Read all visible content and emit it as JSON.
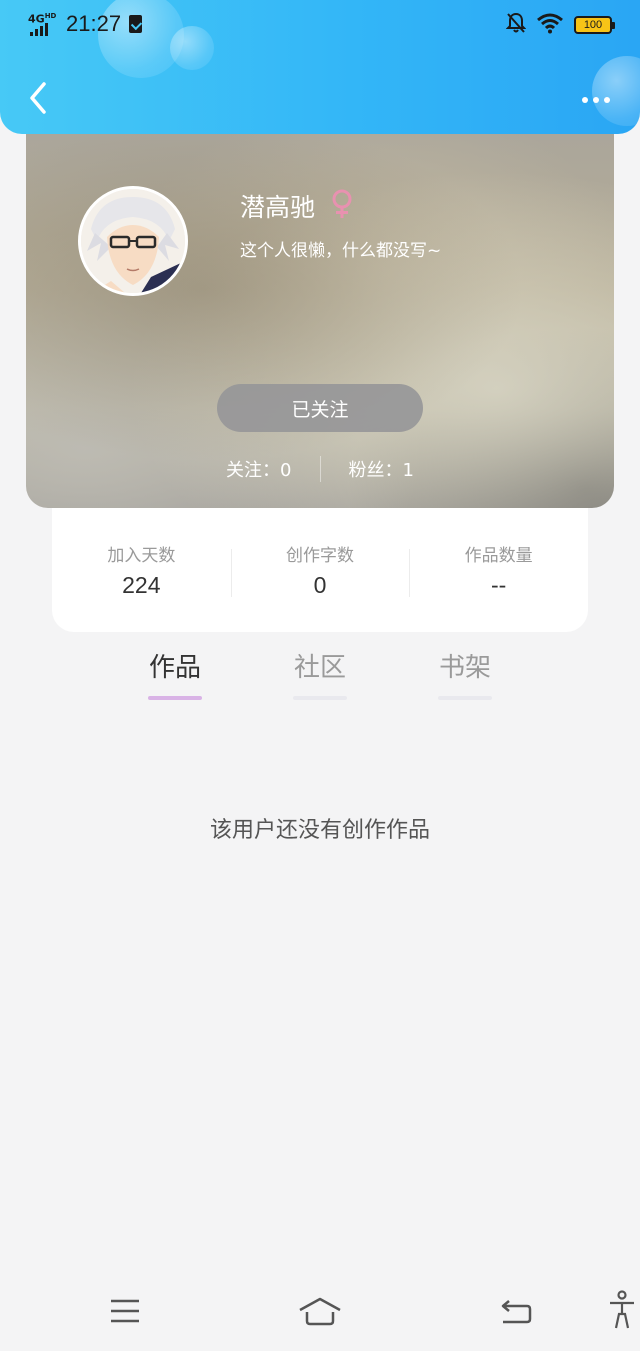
{
  "status_bar": {
    "network": "4G",
    "network_sup": "HD",
    "time": "21:27",
    "battery": "100"
  },
  "icons": {
    "back": "chevron-left-icon",
    "more": "more-dots-icon",
    "gender": "female-icon",
    "menu": "menu-icon",
    "home": "home-icon",
    "back_nav": "back-arrow-icon",
    "accessibility": "accessibility-icon"
  },
  "colors": {
    "header_start": "#47c9f6",
    "header_end": "#2aa6f4",
    "gender": "#e891b0",
    "active_tab_underline": "#d9b3e6"
  },
  "profile": {
    "nickname": "潜高驰",
    "bio": "这个人很懒，什么都没写~",
    "follow_button": "已关注",
    "following_label": "关注：",
    "following_count": "0",
    "followers_label": "粉丝：",
    "followers_count": "1"
  },
  "stats": [
    {
      "label": "加入天数",
      "value": "224"
    },
    {
      "label": "创作字数",
      "value": "0"
    },
    {
      "label": "作品数量",
      "value": "--"
    }
  ],
  "tabs": [
    {
      "label": "作品",
      "active": true
    },
    {
      "label": "社区",
      "active": false
    },
    {
      "label": "书架",
      "active": false
    }
  ],
  "empty_message": "该用户还没有创作作品"
}
